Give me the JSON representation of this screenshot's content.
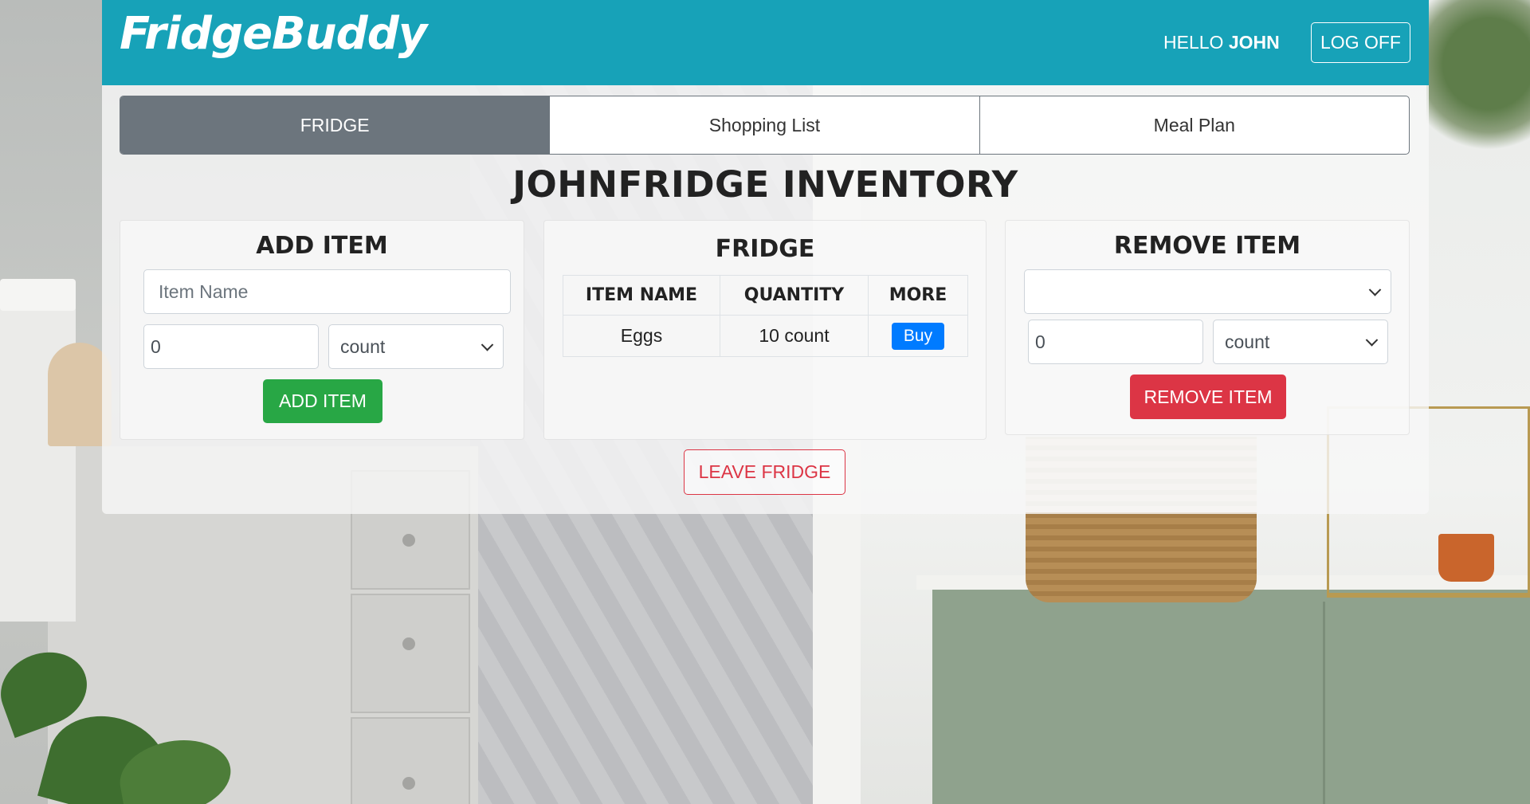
{
  "app": {
    "brand": "FridgeBuddy",
    "greeting_prefix": "HELLO",
    "user_name": "JOHN",
    "logoff_label": "LOG OFF"
  },
  "tabs": [
    {
      "label": "FRIDGE",
      "active": true
    },
    {
      "label": "Shopping List",
      "active": false
    },
    {
      "label": "Meal Plan",
      "active": false
    }
  ],
  "page_title": "JOHNFRIDGE INVENTORY",
  "add_item": {
    "title": "ADD ITEM",
    "name_placeholder": "Item Name",
    "quantity_value": "0",
    "unit_selected": "count",
    "button_label": "ADD ITEM"
  },
  "fridge": {
    "title": "FRIDGE",
    "columns": [
      "ITEM NAME",
      "QUANTITY",
      "MORE"
    ],
    "rows": [
      {
        "name": "Eggs",
        "quantity": "10 count",
        "action": "Buy"
      }
    ]
  },
  "remove_item": {
    "title": "REMOVE ITEM",
    "item_selected": "",
    "quantity_value": "0",
    "unit_selected": "count",
    "button_label": "REMOVE ITEM"
  },
  "leave_fridge_label": "LEAVE FRIDGE",
  "colors": {
    "navbar": "#17a2b8",
    "active_tab": "#6c757d",
    "success": "#28a745",
    "danger": "#dc3545",
    "primary": "#007bff"
  }
}
